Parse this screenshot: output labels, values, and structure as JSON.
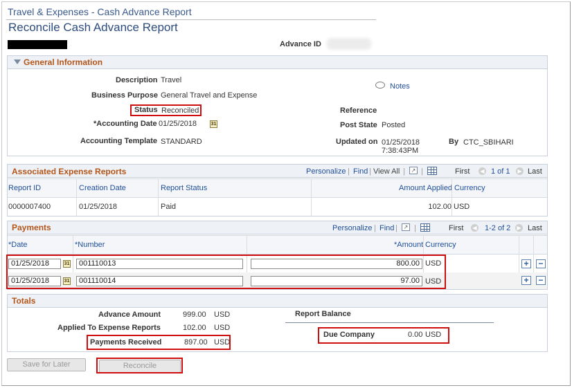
{
  "header": {
    "breadcrumb": "Travel & Expenses - Cash Advance Report",
    "page_title": "Reconcile Cash Advance Report",
    "advance_id_label": "Advance ID"
  },
  "general": {
    "title": "General Information",
    "description_label": "Description",
    "description_value": "Travel",
    "business_purpose_label": "Business Purpose",
    "business_purpose_value": "General Travel and Expense",
    "status_label": "Status",
    "status_value": "Reconciled",
    "accounting_date_label": "*Accounting Date",
    "accounting_date_value": "01/25/2018",
    "accounting_template_label": "Accounting Template",
    "accounting_template_value": "STANDARD",
    "notes_label": "Notes",
    "reference_label": "Reference",
    "post_state_label": "Post State",
    "post_state_value": "Posted",
    "updated_on_label": "Updated on",
    "updated_on_date": "01/25/2018",
    "updated_on_time": "7:38:43PM",
    "by_label": "By",
    "by_value": "CTC_SBIHARI"
  },
  "expense_reports": {
    "title": "Associated Expense Reports",
    "personalize": "Personalize",
    "find": "Find",
    "view_all": "View All",
    "first": "First",
    "range": "1 of 1",
    "last": "Last",
    "columns": [
      "Report ID",
      "Creation Date",
      "Report Status",
      "Amount Applied",
      "Currency"
    ],
    "rows": [
      {
        "report_id": "0000007400",
        "creation_date": "01/25/2018",
        "status": "Paid",
        "amount": "102.00",
        "currency": "USD"
      }
    ]
  },
  "payments": {
    "title": "Payments",
    "personalize": "Personalize",
    "find": "Find",
    "first": "First",
    "range": "1-2 of 2",
    "last": "Last",
    "columns": [
      "*Date",
      "*Number",
      "*Amount",
      "Currency"
    ],
    "rows": [
      {
        "date": "01/25/2018",
        "number": "001110013",
        "amount": "800.00",
        "currency": "USD"
      },
      {
        "date": "01/25/2018",
        "number": "001110014",
        "amount": "97.00",
        "currency": "USD"
      }
    ]
  },
  "totals": {
    "title": "Totals",
    "advance_amount_label": "Advance Amount",
    "advance_amount_value": "999.00",
    "advance_amount_currency": "USD",
    "applied_label": "Applied To Expense Reports",
    "applied_value": "102.00",
    "applied_currency": "USD",
    "payments_received_label": "Payments Received",
    "payments_received_value": "897.00",
    "payments_received_currency": "USD",
    "report_balance_label": "Report Balance",
    "due_company_label": "Due Company",
    "due_company_value": "0.00",
    "due_company_currency": "USD"
  },
  "buttons": {
    "save_for_later": "Save for Later",
    "reconcile": "Reconcile"
  },
  "icons": {
    "calendar": "calendar-icon",
    "notes": "speech-bubble-icon",
    "add_row": "plus-icon",
    "delete_row": "minus-icon",
    "collapse": "triangle-down-icon"
  },
  "colors": {
    "highlight": "#d00d0d",
    "section_title": "#b4561a",
    "link": "#1f4e9a"
  }
}
